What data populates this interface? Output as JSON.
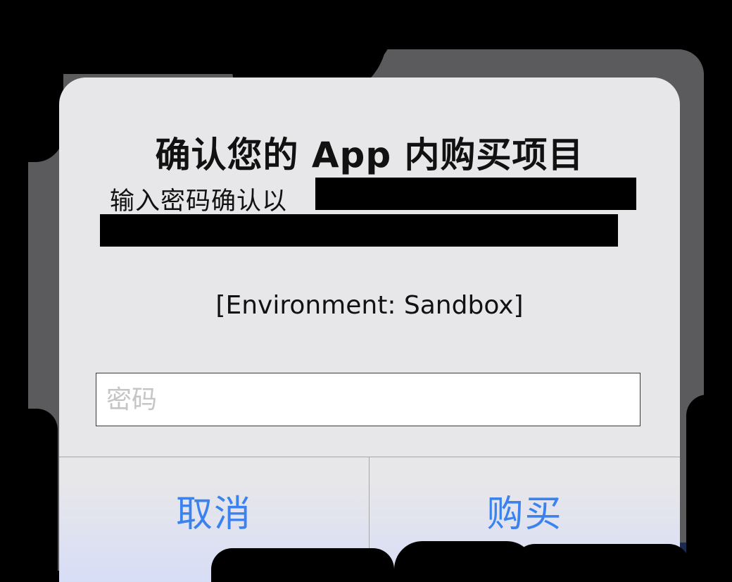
{
  "dialog": {
    "title": "确认您的 App 内购买项目",
    "message_visible": "输入密码确认以",
    "environment": "[Environment: Sandbox]",
    "password_placeholder": "密码",
    "password_value": "",
    "cancel_label": "取消",
    "buy_label": "购买"
  },
  "colors": {
    "button_text": "#3b82ee",
    "dialog_background": "#e7e7e9",
    "backdrop": "#5b5b5d",
    "redaction": "#000000"
  }
}
